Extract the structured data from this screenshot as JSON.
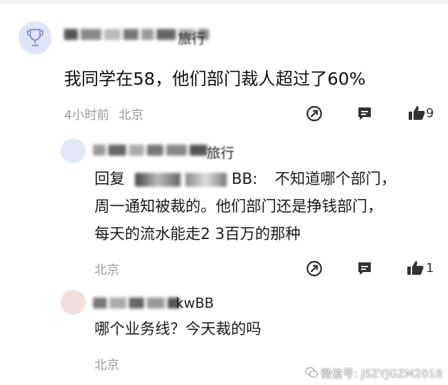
{
  "comment": {
    "username_visible": "旅行",
    "text": "我同学在58，他们部门裁人超过了60%",
    "time": "4小时前",
    "location": "北京",
    "like_count": "9"
  },
  "replies": [
    {
      "username_visible": "旅行",
      "reply_prefix": "回复",
      "reply_target_visible": "BB:",
      "line1": "不知道哪个部门，",
      "line2": "周一通知被裁的。他们部门还是挣钱部门，",
      "line3": "每天的流水能走2 3百万的那种",
      "location": "北京",
      "like_count": "1"
    },
    {
      "username_visible": "kwBB",
      "line1": "哪个业务线？今天裁的吗",
      "location": "北京"
    }
  ],
  "watermark": "微信号: JSZYJGZM2018",
  "icons": {
    "share": "share-icon",
    "comment": "comment-icon",
    "like": "thumbs-up-icon",
    "trophy": "trophy-icon"
  }
}
